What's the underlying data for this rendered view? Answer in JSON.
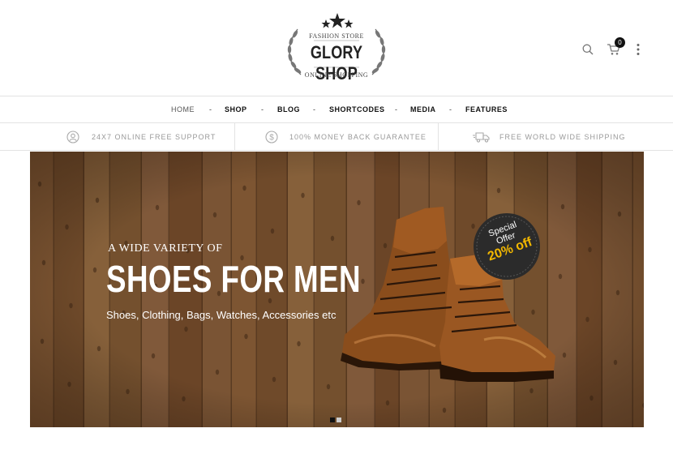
{
  "brand": {
    "tagline_top": "FASHION STORE",
    "name": "GLORY SHOP",
    "tagline_bottom": "ONLINE SHOPPING"
  },
  "header": {
    "cart_count": "0",
    "icons": [
      "search-icon",
      "cart-icon",
      "more-vertical-icon"
    ]
  },
  "nav": {
    "items": [
      {
        "label": "HOME",
        "active": true
      },
      {
        "label": "SHOP"
      },
      {
        "label": "BLOG"
      },
      {
        "label": "SHORTCODES"
      },
      {
        "label": "MEDIA"
      },
      {
        "label": "FEATURES"
      }
    ],
    "separator": "-"
  },
  "features": [
    {
      "icon": "support-icon",
      "text": "24X7 ONLINE FREE SUPPORT"
    },
    {
      "icon": "money-icon",
      "text": "100% MONEY BACK GUARANTEE"
    },
    {
      "icon": "shipping-truck-icon",
      "text": "FREE WORLD WIDE SHIPPING"
    }
  ],
  "hero": {
    "kicker": "A WIDE VARIETY OF",
    "title": "SHOES FOR MEN",
    "subtitle": "Shoes, Clothing, Bags, Watches, Accessories etc",
    "offer_line1": "Special",
    "offer_line2": "Offer",
    "offer_line3": "20% off",
    "slides": 2,
    "active_slide": 1
  },
  "colors": {
    "wood": "#7c5532",
    "offer_yellow": "#f3b800",
    "text_dark": "#111111",
    "muted": "#999999"
  }
}
